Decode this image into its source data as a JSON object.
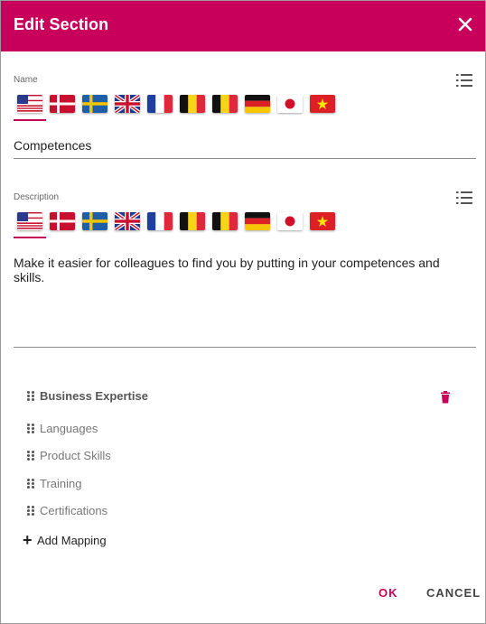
{
  "dialog": {
    "title": "Edit Section",
    "close_icon": "close-icon"
  },
  "name_field": {
    "label": "Name",
    "value": "Competences",
    "selected_language": "en-US",
    "languages_icon": "list-icon"
  },
  "description_field": {
    "label": "Description",
    "value": "Make it easier for colleagues to find you by putting in your competences and skills.",
    "selected_language": "en-US",
    "languages_icon": "list-icon"
  },
  "flags": [
    "flag-us-icon",
    "flag-dk-icon",
    "flag-se-icon",
    "flag-uk-icon",
    "flag-fr-icon",
    "flag-be-icon",
    "flag-be-icon",
    "flag-de-icon",
    "flag-jp-icon",
    "flag-vn-icon"
  ],
  "mappings": {
    "items": [
      {
        "label": "Business Expertise",
        "bold": true,
        "deletable": true
      },
      {
        "label": "Languages"
      },
      {
        "label": "Product Skills"
      },
      {
        "label": "Training"
      },
      {
        "label": "Certifications"
      }
    ],
    "add_label": "Add Mapping"
  },
  "actions": {
    "ok_label": "OK",
    "cancel_label": "CANCEL"
  },
  "colors": {
    "accent": "#c9005b",
    "header_bg": "#c9005b"
  }
}
